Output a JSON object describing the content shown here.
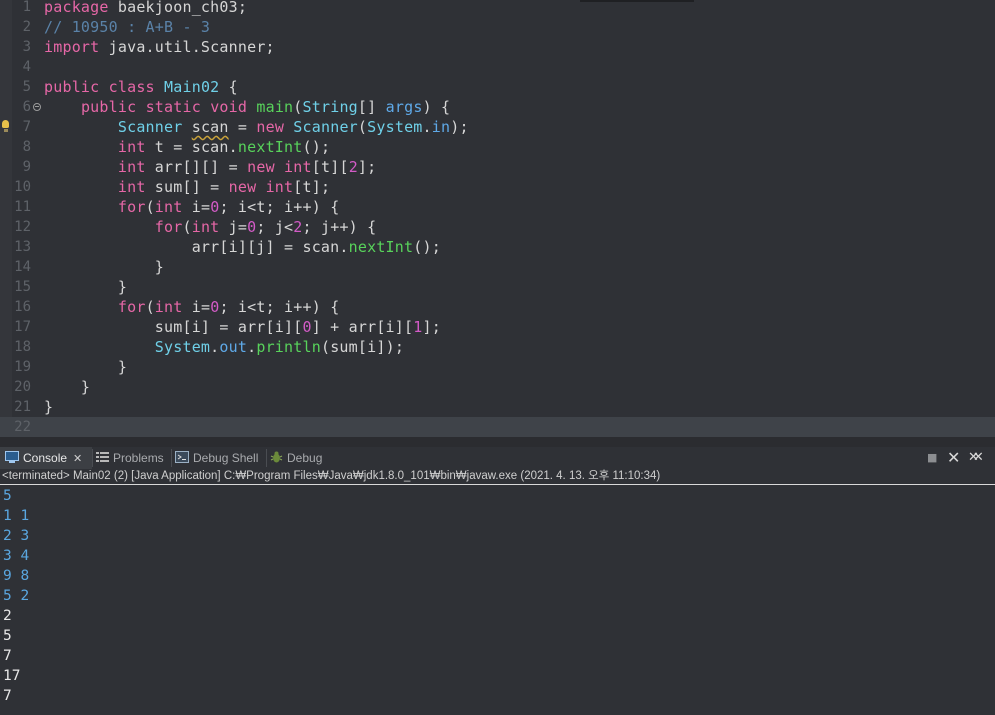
{
  "editor": {
    "lines": [
      {
        "n": "1",
        "tokens": [
          {
            "t": "package",
            "c": "kw"
          },
          {
            "t": " baekjoon_ch03;",
            "c": "txt"
          }
        ]
      },
      {
        "n": "2",
        "tokens": [
          {
            "t": "// 10950 : A+B - 3",
            "c": "cmt"
          }
        ]
      },
      {
        "n": "3",
        "tokens": [
          {
            "t": "import",
            "c": "kw"
          },
          {
            "t": " java.util.Scanner;",
            "c": "txt"
          }
        ]
      },
      {
        "n": "4",
        "tokens": []
      },
      {
        "n": "5",
        "tokens": [
          {
            "t": "public",
            "c": "kw"
          },
          {
            "t": " ",
            "c": "txt"
          },
          {
            "t": "class",
            "c": "kw"
          },
          {
            "t": " ",
            "c": "txt"
          },
          {
            "t": "Main02",
            "c": "cls"
          },
          {
            "t": " {",
            "c": "txt"
          }
        ]
      },
      {
        "n": "6",
        "fold": true,
        "tokens": [
          {
            "t": "    ",
            "c": "txt"
          },
          {
            "t": "public",
            "c": "kw"
          },
          {
            "t": " ",
            "c": "txt"
          },
          {
            "t": "static",
            "c": "kw"
          },
          {
            "t": " ",
            "c": "txt"
          },
          {
            "t": "void",
            "c": "kw"
          },
          {
            "t": " ",
            "c": "txt"
          },
          {
            "t": "main",
            "c": "mth"
          },
          {
            "t": "(",
            "c": "txt"
          },
          {
            "t": "String",
            "c": "cls"
          },
          {
            "t": "[] ",
            "c": "txt"
          },
          {
            "t": "args",
            "c": "fld"
          },
          {
            "t": ") {",
            "c": "txt"
          }
        ]
      },
      {
        "n": "7",
        "bulb": true,
        "tokens": [
          {
            "t": "        ",
            "c": "txt"
          },
          {
            "t": "Scanner",
            "c": "cls"
          },
          {
            "t": " ",
            "c": "txt"
          },
          {
            "t": "scan",
            "c": "warn"
          },
          {
            "t": " = ",
            "c": "txt"
          },
          {
            "t": "new",
            "c": "kw"
          },
          {
            "t": " ",
            "c": "txt"
          },
          {
            "t": "Scanner",
            "c": "cls"
          },
          {
            "t": "(",
            "c": "txt"
          },
          {
            "t": "System",
            "c": "cls"
          },
          {
            "t": ".",
            "c": "txt"
          },
          {
            "t": "in",
            "c": "fld"
          },
          {
            "t": ");",
            "c": "txt"
          }
        ]
      },
      {
        "n": "8",
        "tokens": [
          {
            "t": "        ",
            "c": "txt"
          },
          {
            "t": "int",
            "c": "kw"
          },
          {
            "t": " t = scan.",
            "c": "txt"
          },
          {
            "t": "nextInt",
            "c": "mth"
          },
          {
            "t": "();",
            "c": "txt"
          }
        ]
      },
      {
        "n": "9",
        "tokens": [
          {
            "t": "        ",
            "c": "txt"
          },
          {
            "t": "int",
            "c": "kw"
          },
          {
            "t": " arr[][] = ",
            "c": "txt"
          },
          {
            "t": "new",
            "c": "kw"
          },
          {
            "t": " ",
            "c": "txt"
          },
          {
            "t": "int",
            "c": "kw"
          },
          {
            "t": "[t][",
            "c": "txt"
          },
          {
            "t": "2",
            "c": "num"
          },
          {
            "t": "];",
            "c": "txt"
          }
        ]
      },
      {
        "n": "10",
        "tokens": [
          {
            "t": "        ",
            "c": "txt"
          },
          {
            "t": "int",
            "c": "kw"
          },
          {
            "t": " sum[] = ",
            "c": "txt"
          },
          {
            "t": "new",
            "c": "kw"
          },
          {
            "t": " ",
            "c": "txt"
          },
          {
            "t": "int",
            "c": "kw"
          },
          {
            "t": "[t];",
            "c": "txt"
          }
        ]
      },
      {
        "n": "11",
        "tokens": [
          {
            "t": "        ",
            "c": "txt"
          },
          {
            "t": "for",
            "c": "kw"
          },
          {
            "t": "(",
            "c": "txt"
          },
          {
            "t": "int",
            "c": "kw"
          },
          {
            "t": " i=",
            "c": "txt"
          },
          {
            "t": "0",
            "c": "num"
          },
          {
            "t": "; i<t; i++) {",
            "c": "txt"
          }
        ]
      },
      {
        "n": "12",
        "tokens": [
          {
            "t": "            ",
            "c": "txt"
          },
          {
            "t": "for",
            "c": "kw"
          },
          {
            "t": "(",
            "c": "txt"
          },
          {
            "t": "int",
            "c": "kw"
          },
          {
            "t": " j=",
            "c": "txt"
          },
          {
            "t": "0",
            "c": "num"
          },
          {
            "t": "; j<",
            "c": "txt"
          },
          {
            "t": "2",
            "c": "num"
          },
          {
            "t": "; j++) {",
            "c": "txt"
          }
        ]
      },
      {
        "n": "13",
        "tokens": [
          {
            "t": "                arr[i][j] = scan.",
            "c": "txt"
          },
          {
            "t": "nextInt",
            "c": "mth"
          },
          {
            "t": "();",
            "c": "txt"
          }
        ]
      },
      {
        "n": "14",
        "tokens": [
          {
            "t": "            }",
            "c": "txt"
          }
        ]
      },
      {
        "n": "15",
        "tokens": [
          {
            "t": "        }",
            "c": "txt"
          }
        ]
      },
      {
        "n": "16",
        "tokens": [
          {
            "t": "        ",
            "c": "txt"
          },
          {
            "t": "for",
            "c": "kw"
          },
          {
            "t": "(",
            "c": "txt"
          },
          {
            "t": "int",
            "c": "kw"
          },
          {
            "t": " i=",
            "c": "txt"
          },
          {
            "t": "0",
            "c": "num"
          },
          {
            "t": "; i<t; i++) {",
            "c": "txt"
          }
        ]
      },
      {
        "n": "17",
        "tokens": [
          {
            "t": "            sum[i] = arr[i][",
            "c": "txt"
          },
          {
            "t": "0",
            "c": "num"
          },
          {
            "t": "] + arr[i][",
            "c": "txt"
          },
          {
            "t": "1",
            "c": "num"
          },
          {
            "t": "];",
            "c": "txt"
          }
        ]
      },
      {
        "n": "18",
        "tokens": [
          {
            "t": "            ",
            "c": "txt"
          },
          {
            "t": "System",
            "c": "cls"
          },
          {
            "t": ".",
            "c": "txt"
          },
          {
            "t": "out",
            "c": "fld"
          },
          {
            "t": ".",
            "c": "txt"
          },
          {
            "t": "println",
            "c": "mth"
          },
          {
            "t": "(sum[i]);",
            "c": "txt"
          }
        ]
      },
      {
        "n": "19",
        "tokens": [
          {
            "t": "        }",
            "c": "txt"
          }
        ]
      },
      {
        "n": "20",
        "tokens": [
          {
            "t": "    }",
            "c": "txt"
          }
        ]
      },
      {
        "n": "21",
        "tokens": [
          {
            "t": "}",
            "c": "txt"
          }
        ]
      },
      {
        "n": "22",
        "current": true,
        "tokens": []
      }
    ]
  },
  "console": {
    "tabs": [
      {
        "id": "console",
        "label": "Console",
        "icon": "console-icon",
        "active": true,
        "close": "✕"
      },
      {
        "id": "problems",
        "label": "Problems",
        "icon": "problems-icon",
        "active": false
      },
      {
        "id": "debug-shell",
        "label": "Debug Shell",
        "icon": "debug-shell-icon",
        "active": false
      },
      {
        "id": "debug",
        "label": "Debug",
        "icon": "debug-bug-icon",
        "active": false
      }
    ],
    "toolbar": {
      "terminate": "■",
      "remove": "✕",
      "remove_all": "✕✕"
    },
    "status": "<terminated> Main02 (2) [Java Application] C:₩Program Files₩Java₩jdk1.8.0_101₩bin₩javaw.exe (2021. 4. 13. 오후 11:10:34)",
    "output": [
      {
        "text": "5",
        "kind": "input"
      },
      {
        "text": "1 1",
        "kind": "input"
      },
      {
        "text": "2 3",
        "kind": "input"
      },
      {
        "text": "3 4",
        "kind": "input"
      },
      {
        "text": "9 8",
        "kind": "input"
      },
      {
        "text": "5 2",
        "kind": "input"
      },
      {
        "text": "2",
        "kind": "output"
      },
      {
        "text": "5",
        "kind": "output"
      },
      {
        "text": "7",
        "kind": "output"
      },
      {
        "text": "17",
        "kind": "output"
      },
      {
        "text": "7",
        "kind": "output"
      }
    ]
  },
  "colors": {
    "background": "#2f3136",
    "keyword": "#e667a7",
    "class": "#6fd0e8",
    "method": "#58d35b",
    "field": "#5fa9e8",
    "number": "#d35bc7",
    "comment": "#5a82a8",
    "console_input": "#5aa7e0"
  }
}
